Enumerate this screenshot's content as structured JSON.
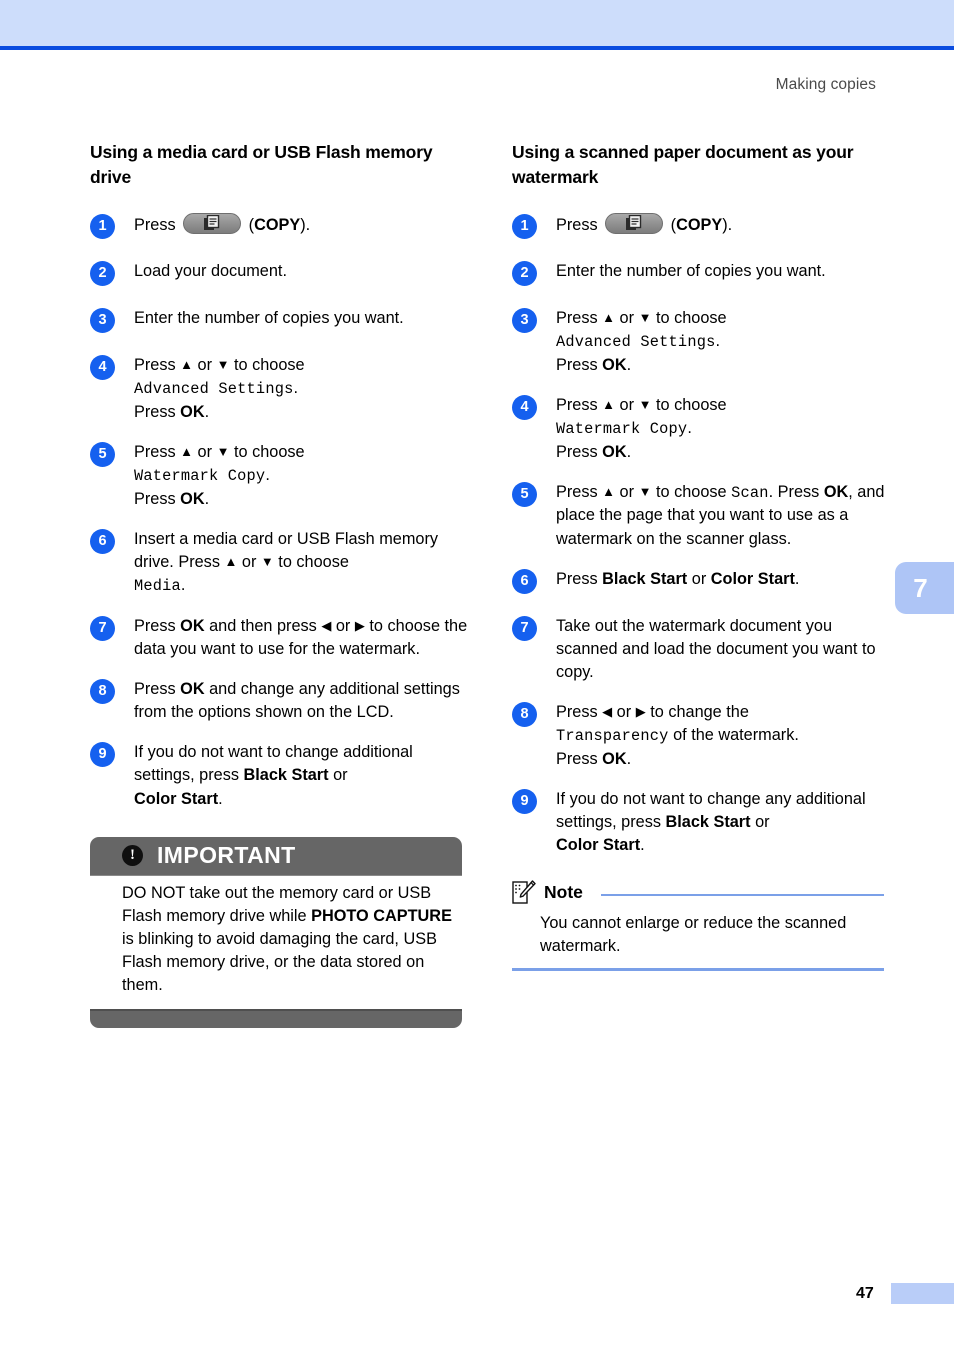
{
  "header": {
    "running_title": "Making copies"
  },
  "left_column": {
    "heading": "Using a media card or USB Flash memory drive",
    "steps": [
      {
        "num": "1",
        "parts": [
          {
            "t": "text",
            "v": "Press "
          },
          {
            "t": "key",
            "v": "copy-key-icon"
          },
          {
            "t": "text",
            "v": " ("
          },
          {
            "t": "bold",
            "v": "COPY"
          },
          {
            "t": "text",
            "v": ")."
          }
        ]
      },
      {
        "num": "2",
        "parts": [
          {
            "t": "text",
            "v": "Load your document."
          }
        ]
      },
      {
        "num": "3",
        "parts": [
          {
            "t": "text",
            "v": "Enter the number of copies you want."
          }
        ]
      },
      {
        "num": "4",
        "parts": [
          {
            "t": "text",
            "v": "Press "
          },
          {
            "t": "glyph",
            "v": "▲"
          },
          {
            "t": "text",
            "v": " or "
          },
          {
            "t": "glyph",
            "v": "▼"
          },
          {
            "t": "text",
            "v": " to choose"
          },
          {
            "t": "br"
          },
          {
            "t": "lcd",
            "v": "Advanced Settings"
          },
          {
            "t": "text",
            "v": "."
          },
          {
            "t": "br"
          },
          {
            "t": "text",
            "v": "Press "
          },
          {
            "t": "bold",
            "v": "OK"
          },
          {
            "t": "text",
            "v": "."
          }
        ]
      },
      {
        "num": "5",
        "parts": [
          {
            "t": "text",
            "v": "Press "
          },
          {
            "t": "glyph",
            "v": "▲"
          },
          {
            "t": "text",
            "v": " or "
          },
          {
            "t": "glyph",
            "v": "▼"
          },
          {
            "t": "text",
            "v": " to choose"
          },
          {
            "t": "br"
          },
          {
            "t": "lcd",
            "v": "Watermark Copy"
          },
          {
            "t": "text",
            "v": "."
          },
          {
            "t": "br"
          },
          {
            "t": "text",
            "v": "Press "
          },
          {
            "t": "bold",
            "v": "OK"
          },
          {
            "t": "text",
            "v": "."
          }
        ]
      },
      {
        "num": "6",
        "parts": [
          {
            "t": "text",
            "v": "Insert a media card or USB Flash memory drive. Press "
          },
          {
            "t": "glyph",
            "v": "▲"
          },
          {
            "t": "text",
            "v": " or "
          },
          {
            "t": "glyph",
            "v": "▼"
          },
          {
            "t": "text",
            "v": " to choose"
          },
          {
            "t": "br"
          },
          {
            "t": "lcd",
            "v": "Media"
          },
          {
            "t": "text",
            "v": "."
          }
        ]
      },
      {
        "num": "7",
        "parts": [
          {
            "t": "text",
            "v": "Press "
          },
          {
            "t": "bold",
            "v": "OK"
          },
          {
            "t": "text",
            "v": " and then press "
          },
          {
            "t": "glyph",
            "v": "◀"
          },
          {
            "t": "text",
            "v": " or "
          },
          {
            "t": "glyph",
            "v": "▶"
          },
          {
            "t": "text",
            "v": " to choose the data you want to use for the watermark."
          }
        ]
      },
      {
        "num": "8",
        "parts": [
          {
            "t": "text",
            "v": "Press "
          },
          {
            "t": "bold",
            "v": "OK"
          },
          {
            "t": "text",
            "v": " and change any additional settings from the options shown on the LCD."
          }
        ]
      },
      {
        "num": "9",
        "parts": [
          {
            "t": "text",
            "v": "If you do not want to change additional settings, press "
          },
          {
            "t": "bold",
            "v": "Black Start"
          },
          {
            "t": "text",
            "v": " or "
          },
          {
            "t": "br"
          },
          {
            "t": "bold",
            "v": "Color Start"
          },
          {
            "t": "text",
            "v": "."
          }
        ]
      }
    ],
    "important": {
      "icon": "exclamation-icon",
      "title": "IMPORTANT",
      "body_parts": [
        {
          "t": "text",
          "v": "DO NOT take out the memory card or USB Flash memory drive while "
        },
        {
          "t": "bold",
          "v": "PHOTO CAPTURE"
        },
        {
          "t": "text",
          "v": " is blinking to avoid damaging the card, USB Flash memory drive, or the data stored on them."
        }
      ]
    }
  },
  "right_column": {
    "heading": "Using a scanned paper document as your watermark",
    "steps": [
      {
        "num": "1",
        "parts": [
          {
            "t": "text",
            "v": "Press "
          },
          {
            "t": "key",
            "v": "copy-key-icon"
          },
          {
            "t": "text",
            "v": " ("
          },
          {
            "t": "bold",
            "v": "COPY"
          },
          {
            "t": "text",
            "v": ")."
          }
        ]
      },
      {
        "num": "2",
        "parts": [
          {
            "t": "text",
            "v": "Enter the number of copies you want."
          }
        ]
      },
      {
        "num": "3",
        "parts": [
          {
            "t": "text",
            "v": "Press "
          },
          {
            "t": "glyph",
            "v": "▲"
          },
          {
            "t": "text",
            "v": " or "
          },
          {
            "t": "glyph",
            "v": "▼"
          },
          {
            "t": "text",
            "v": " to choose"
          },
          {
            "t": "br"
          },
          {
            "t": "lcd",
            "v": "Advanced Settings"
          },
          {
            "t": "text",
            "v": "."
          },
          {
            "t": "br"
          },
          {
            "t": "text",
            "v": "Press "
          },
          {
            "t": "bold",
            "v": "OK"
          },
          {
            "t": "text",
            "v": "."
          }
        ]
      },
      {
        "num": "4",
        "parts": [
          {
            "t": "text",
            "v": "Press "
          },
          {
            "t": "glyph",
            "v": "▲"
          },
          {
            "t": "text",
            "v": " or "
          },
          {
            "t": "glyph",
            "v": "▼"
          },
          {
            "t": "text",
            "v": " to choose"
          },
          {
            "t": "br"
          },
          {
            "t": "lcd",
            "v": "Watermark Copy"
          },
          {
            "t": "text",
            "v": "."
          },
          {
            "t": "br"
          },
          {
            "t": "text",
            "v": "Press "
          },
          {
            "t": "bold",
            "v": "OK"
          },
          {
            "t": "text",
            "v": "."
          }
        ]
      },
      {
        "num": "5",
        "parts": [
          {
            "t": "text",
            "v": "Press "
          },
          {
            "t": "glyph",
            "v": "▲"
          },
          {
            "t": "text",
            "v": " or "
          },
          {
            "t": "glyph",
            "v": "▼"
          },
          {
            "t": "text",
            "v": " to choose "
          },
          {
            "t": "lcd",
            "v": "Scan"
          },
          {
            "t": "text",
            "v": ". Press "
          },
          {
            "t": "bold",
            "v": "OK"
          },
          {
            "t": "text",
            "v": ", and place the page that you want to use as a watermark on the scanner glass."
          }
        ]
      },
      {
        "num": "6",
        "parts": [
          {
            "t": "text",
            "v": "Press "
          },
          {
            "t": "bold",
            "v": "Black Start"
          },
          {
            "t": "text",
            "v": " or "
          },
          {
            "t": "bold",
            "v": "Color Start"
          },
          {
            "t": "text",
            "v": "."
          }
        ]
      },
      {
        "num": "7",
        "parts": [
          {
            "t": "text",
            "v": "Take out the watermark document you scanned and load the document you want to copy."
          }
        ]
      },
      {
        "num": "8",
        "parts": [
          {
            "t": "text",
            "v": "Press "
          },
          {
            "t": "glyph",
            "v": "◀"
          },
          {
            "t": "text",
            "v": " or "
          },
          {
            "t": "glyph",
            "v": "▶"
          },
          {
            "t": "text",
            "v": " to change the"
          },
          {
            "t": "br"
          },
          {
            "t": "lcd",
            "v": "Transparency"
          },
          {
            "t": "text",
            "v": " of the watermark."
          },
          {
            "t": "br"
          },
          {
            "t": "text",
            "v": "Press "
          },
          {
            "t": "bold",
            "v": "OK"
          },
          {
            "t": "text",
            "v": "."
          }
        ]
      },
      {
        "num": "9",
        "parts": [
          {
            "t": "text",
            "v": "If you do not want to change any additional settings, press "
          },
          {
            "t": "bold",
            "v": "Black Start"
          },
          {
            "t": "text",
            "v": " or "
          },
          {
            "t": "br"
          },
          {
            "t": "bold",
            "v": "Color Start"
          },
          {
            "t": "text",
            "v": "."
          }
        ]
      }
    ],
    "note": {
      "icon": "note-pencil-icon",
      "title": "Note",
      "body": "You cannot enlarge or reduce the scanned watermark."
    }
  },
  "chapter_tab": {
    "label": "7"
  },
  "footer": {
    "page_number": "47"
  },
  "colors": {
    "step_circle": "#1560ef",
    "top_band": "#cdddfb",
    "top_rule": "#0a4ce0",
    "important_bar": "#666666",
    "note_rule": "#7ba0e8",
    "chapter_tab": "#aec5f6",
    "footer_block": "#b9cdf8"
  }
}
